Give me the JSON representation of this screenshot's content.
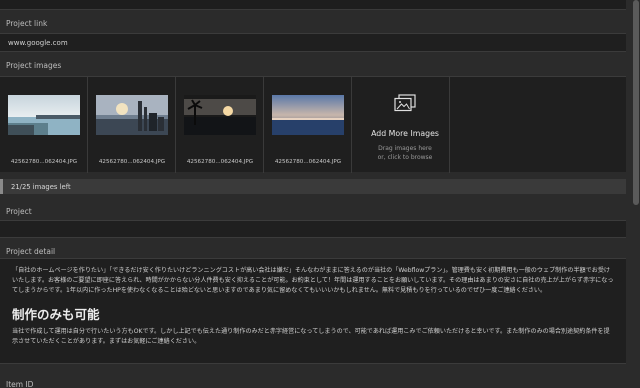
{
  "project_link": {
    "label": "Project link",
    "value": "www.google.com"
  },
  "project_images": {
    "label": "Project images",
    "items": [
      {
        "filename": "42562780...062404.JPG"
      },
      {
        "filename": "42562780...062404.JPG"
      },
      {
        "filename": "42562780...062404.JPG"
      },
      {
        "filename": "42562780...062404.JPG"
      }
    ],
    "add_more": {
      "title": "Add More Images",
      "subtitle_line1": "Drag images here",
      "subtitle_line2": "or, click to browse",
      "icon": "images-icon"
    },
    "counter": "21/25 images left"
  },
  "project": {
    "label": "Project",
    "value": ""
  },
  "project_detail": {
    "label": "Project detail",
    "paragraph1": "「自社のホームページを作りたい」「できるだけ安く作りたいけどランニングコストが高い会社は嫌だ」そんなわがままに答えるのが当社の「Webflowプラン」。管理費も安く初期費用も一般のウェブ制作の半額でお受けいたします。お客様のご要望に即座に答えられ、時間がかからない分人件費も安く抑えることが可能。お約束として！年間は運用することをお願いしています。その理由はあまりの安さに自社の売上が上がらず赤字になってしまうからです。1年以内に作ったHPを使わなくなることは殆どないと思いますのであまり気に留めなくてもいいいかもしれません。無料で見積もりを行っているのでぜひ一度ご連絡ください。",
    "heading": "制作のみも可能",
    "paragraph2": "当社で作成して運用は自分で行いたいう方もOKです。しかし上記でも伝えた通り制作のみだと赤字経営になってしまうので、可能であれば運用こみでご依頼いただけると幸いです。また制作のみの場合別途契約条件を提示させていただくことがあります。まずはお気軽にご連絡ください。"
  },
  "item_id": {
    "label": "Item ID"
  },
  "colors": {
    "background": "#2b2b2b",
    "field": "#1f1f1f",
    "text": "#cfcfcf"
  }
}
